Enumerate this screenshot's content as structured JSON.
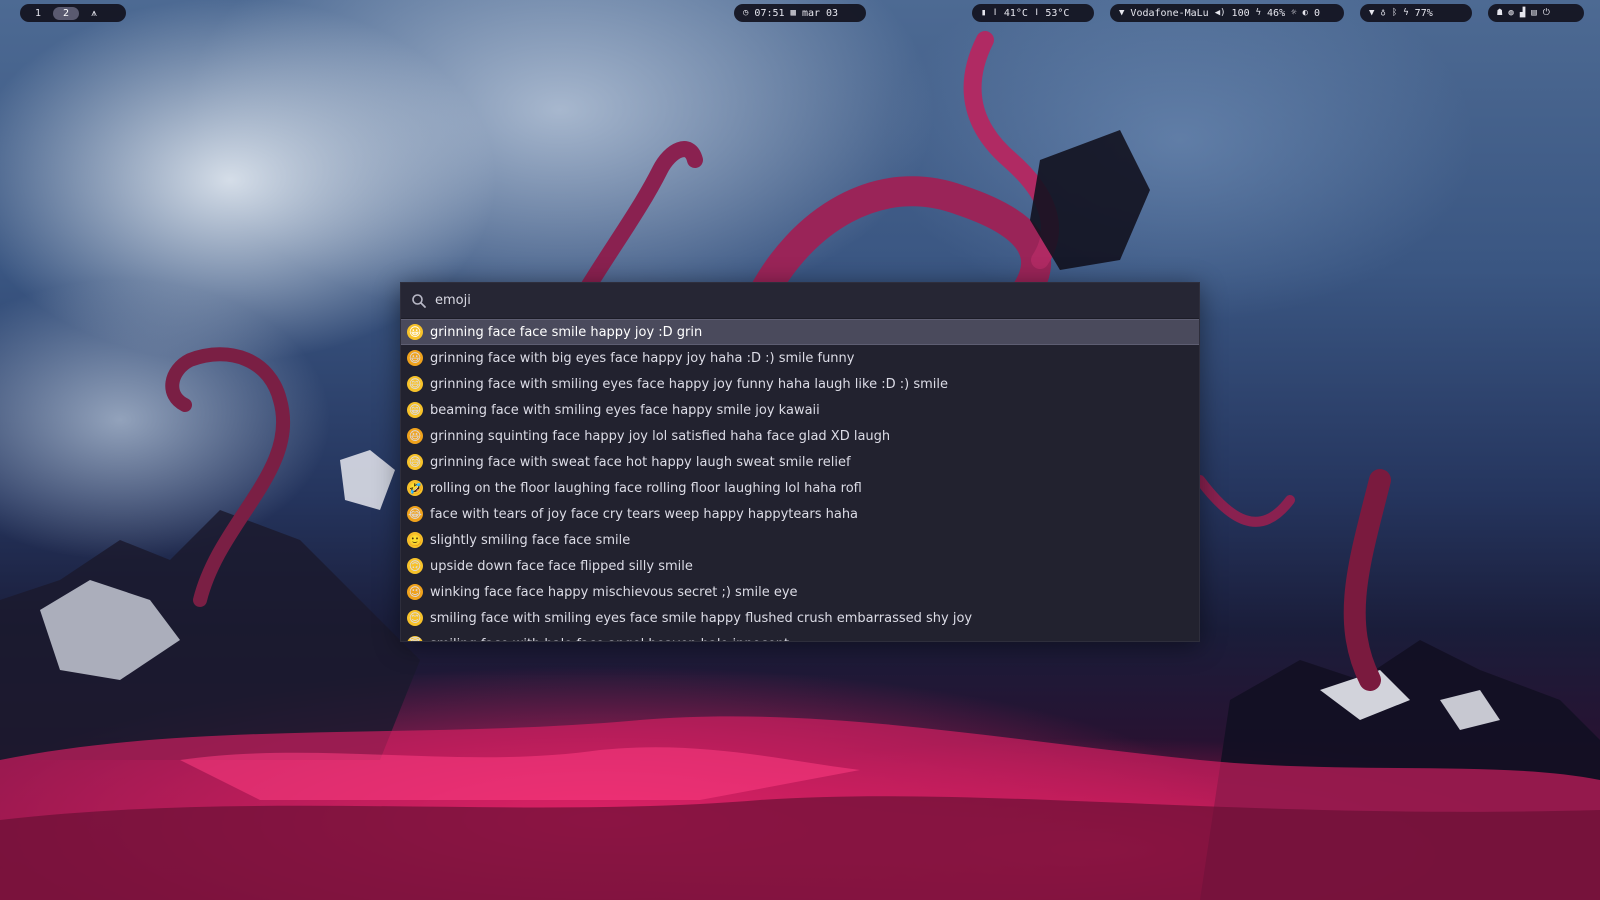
{
  "bar": {
    "workspaces": [
      "1",
      "2"
    ],
    "active_workspace": "2",
    "layout_glyph": "⩚",
    "time": "07:51",
    "date": "mar 03",
    "cpu_temp": "41°C",
    "gpu_temp": "53°C",
    "wifi": "Vodafone-MaLu",
    "volume": "100",
    "brightness": "46%",
    "night": "0",
    "battery": "77%"
  },
  "launcher": {
    "query": "emoji",
    "items": [
      {
        "emoji": "😀",
        "text": "grinning face face smile happy joy :D grin"
      },
      {
        "emoji": "😃",
        "text": "grinning face with big eyes face happy joy haha :D :) smile funny"
      },
      {
        "emoji": "😄",
        "text": "grinning face with smiling eyes face happy joy funny haha laugh like :D :) smile"
      },
      {
        "emoji": "😁",
        "text": "beaming face with smiling eyes face happy smile joy kawaii"
      },
      {
        "emoji": "😆",
        "text": "grinning squinting face happy joy lol satisfied haha face glad XD laugh"
      },
      {
        "emoji": "😅",
        "text": "grinning face with sweat face hot happy laugh sweat smile relief"
      },
      {
        "emoji": "🤣",
        "text": "rolling on the floor laughing face rolling floor laughing lol haha rofl"
      },
      {
        "emoji": "😂",
        "text": "face with tears of joy face cry tears weep happy happytears haha"
      },
      {
        "emoji": "🙂",
        "text": "slightly smiling face face smile"
      },
      {
        "emoji": "🙃",
        "text": "upside down face face flipped silly smile"
      },
      {
        "emoji": "😉",
        "text": "winking face face happy mischievous secret ;) smile eye"
      },
      {
        "emoji": "😊",
        "text": "smiling face with smiling eyes face smile happy flushed crush embarrassed shy joy"
      },
      {
        "emoji": "😇",
        "text": "smiling face with halo face angel heaven halo innocent"
      }
    ]
  },
  "colors": {
    "emoji_yellow": "#f7c22a",
    "emoji_orange": "#f0a21c",
    "selected_row": "#4a4a5c",
    "panel_bg": "#22222f"
  }
}
